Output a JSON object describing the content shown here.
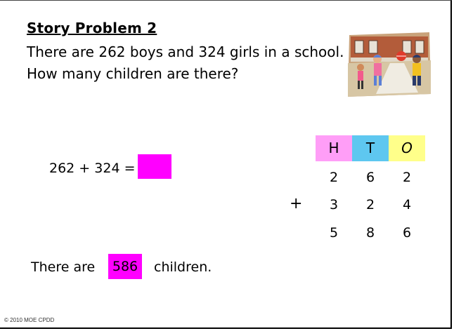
{
  "heading": "Story Problem 2",
  "problem": {
    "line1": "There are 262 boys and 324 girls in a school.",
    "line2": "How many children are there?"
  },
  "equation": "262 + 324 =",
  "hto": {
    "headers": [
      "H",
      "T",
      "O"
    ],
    "addend1": [
      "2",
      "6",
      "2"
    ],
    "operator": "+",
    "addend2": [
      "3",
      "2",
      "4"
    ],
    "sum": [
      "5",
      "8",
      "6"
    ]
  },
  "sentence": {
    "before": "There are",
    "answer": "586",
    "after": "children."
  },
  "footer": "© 2010 MOE CPDD",
  "colors": {
    "magenta": "#ff00ff",
    "hundreds": "#ff9ef7",
    "tens": "#5ec7f0",
    "ones": "#ffff8a"
  }
}
